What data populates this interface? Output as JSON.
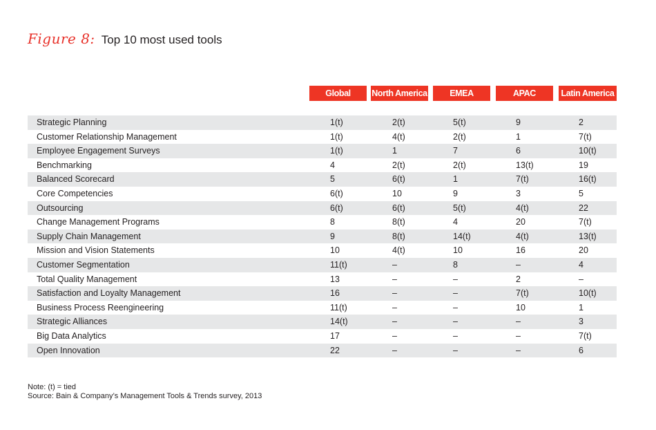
{
  "figure": {
    "label": "Figure 8:",
    "title": "Top 10 most used tools"
  },
  "table": {
    "columns": [
      "Global",
      "North America",
      "EMEA",
      "APAC",
      "Latin America"
    ],
    "header_color": "#ee3524",
    "stripe_color": "#e6e7e8",
    "rows": [
      {
        "tool": "Strategic Planning",
        "values": [
          "1(t)",
          "2(t)",
          "5(t)",
          "9",
          "2"
        ]
      },
      {
        "tool": "Customer Relationship Management",
        "values": [
          "1(t)",
          "4(t)",
          "2(t)",
          "1",
          "7(t)"
        ]
      },
      {
        "tool": "Employee Engagement Surveys",
        "values": [
          "1(t)",
          "1",
          "7",
          "6",
          "10(t)"
        ]
      },
      {
        "tool": "Benchmarking",
        "values": [
          "4",
          "2(t)",
          "2(t)",
          "13(t)",
          "19"
        ]
      },
      {
        "tool": "Balanced Scorecard",
        "values": [
          "5",
          "6(t)",
          "1",
          "7(t)",
          "16(t)"
        ]
      },
      {
        "tool": "Core Competencies",
        "values": [
          "6(t)",
          "10",
          "9",
          "3",
          "5"
        ]
      },
      {
        "tool": "Outsourcing",
        "values": [
          "6(t)",
          "6(t)",
          "5(t)",
          "4(t)",
          "22"
        ]
      },
      {
        "tool": "Change Management Programs",
        "values": [
          "8",
          "8(t)",
          "4",
          "20",
          "7(t)"
        ]
      },
      {
        "tool": "Supply Chain Management",
        "values": [
          "9",
          "8(t)",
          "14(t)",
          "4(t)",
          "13(t)"
        ]
      },
      {
        "tool": "Mission and Vision Statements",
        "values": [
          "10",
          "4(t)",
          "10",
          "16",
          "20"
        ]
      },
      {
        "tool": "Customer Segmentation",
        "values": [
          "11(t)",
          "–",
          "8",
          "–",
          "4"
        ]
      },
      {
        "tool": "Total Quality Management",
        "values": [
          "13",
          "–",
          "–",
          "2",
          "–"
        ]
      },
      {
        "tool": "Satisfaction and Loyalty Management",
        "values": [
          "16",
          "–",
          "–",
          "7(t)",
          "10(t)"
        ]
      },
      {
        "tool": "Business Process Reengineering",
        "values": [
          "11(t)",
          "–",
          "–",
          "10",
          "1"
        ]
      },
      {
        "tool": "Strategic Alliances",
        "values": [
          "14(t)",
          "–",
          "–",
          "–",
          "3"
        ]
      },
      {
        "tool": "Big Data Analytics",
        "values": [
          "17",
          "–",
          "–",
          "–",
          "7(t)"
        ]
      },
      {
        "tool": "Open Innovation",
        "values": [
          "22",
          "–",
          "–",
          "–",
          "6"
        ]
      }
    ]
  },
  "footnote": {
    "note": "Note: (t) = tied",
    "source": "Source: Bain & Company’s Management Tools & Trends survey, 2013"
  }
}
